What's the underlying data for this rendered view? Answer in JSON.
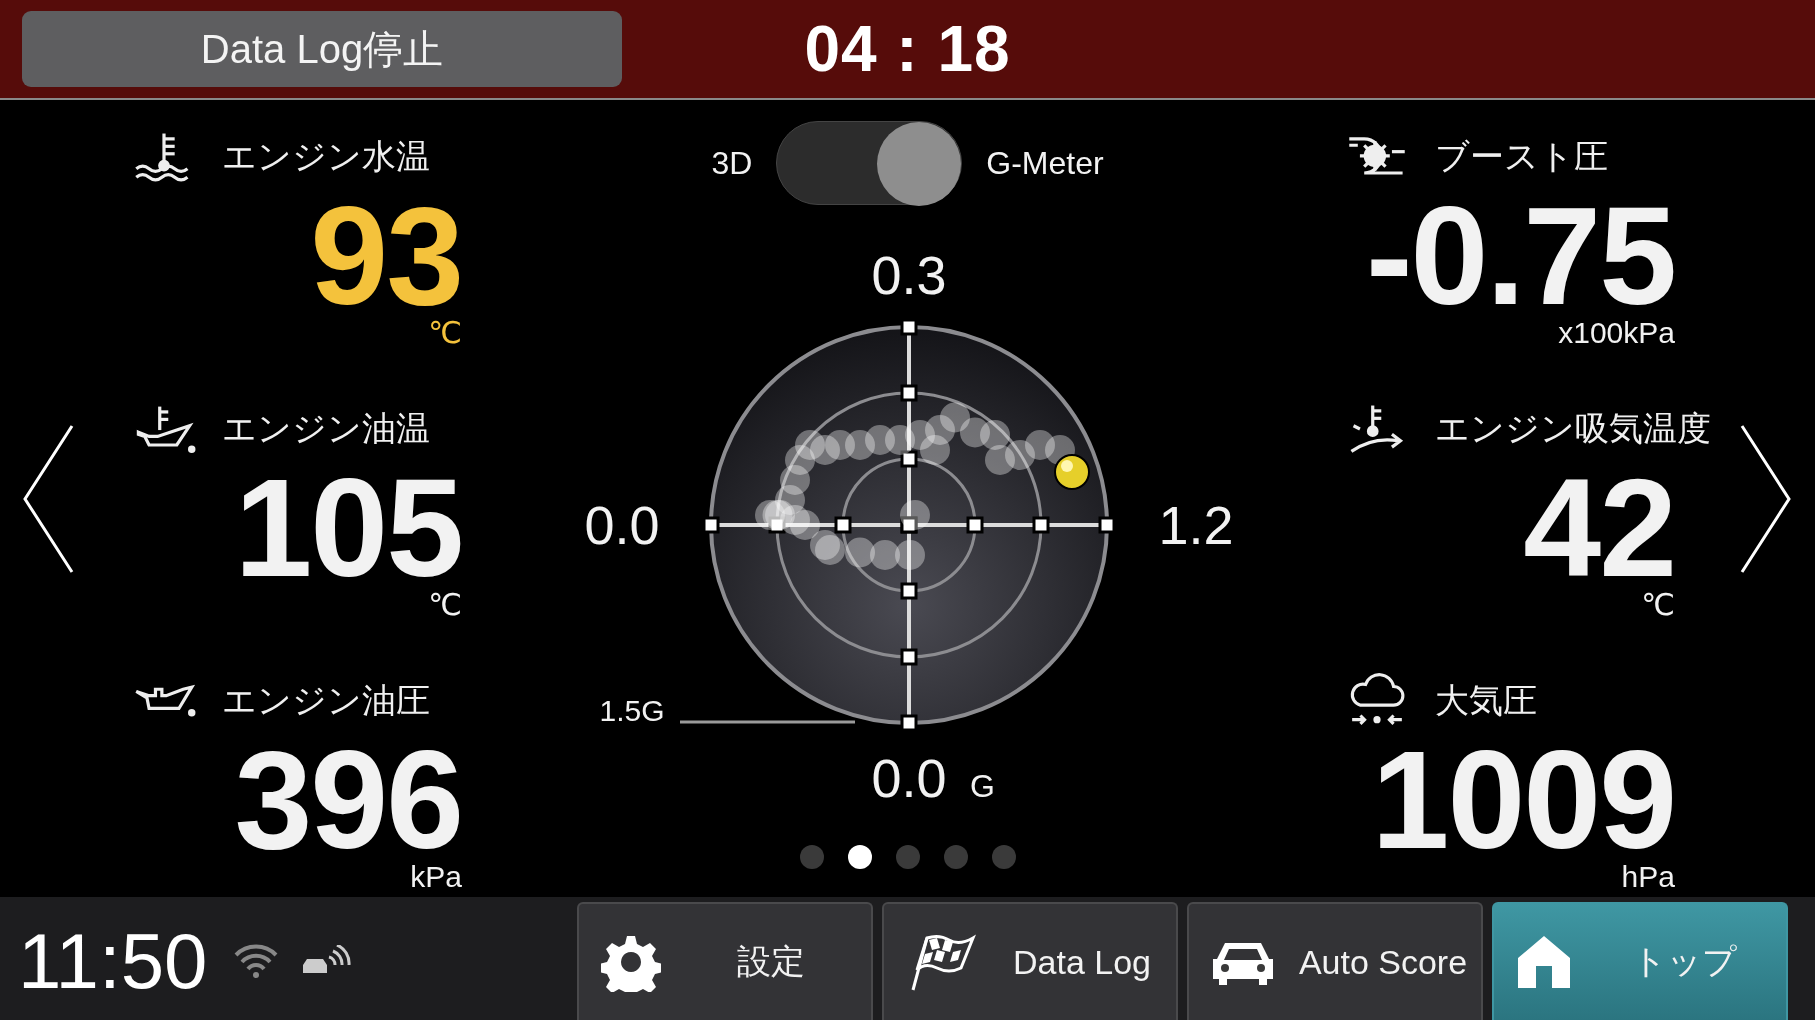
{
  "top_bar": {
    "log_button": "Data Log停止",
    "timer": "04 : 18"
  },
  "left_metrics": [
    {
      "kind": "coolant",
      "label": "エンジン水温",
      "value": "93",
      "unit": "℃",
      "alert": true
    },
    {
      "kind": "oil_temp",
      "label": "エンジン油温",
      "value": "105",
      "unit": "℃",
      "alert": false
    },
    {
      "kind": "oil_pressure",
      "label": "エンジン油圧",
      "value": "396",
      "unit": "kPa",
      "alert": false
    }
  ],
  "view_toggle": {
    "left_label": "3D",
    "right_label": "G-Meter",
    "on": true
  },
  "g_meter": {
    "top_reading": "0.3",
    "left_reading": "0.0",
    "right_reading": "1.2",
    "bottom_reading": "0.0",
    "bottom_unit": "G",
    "scale_label": "1.5G"
  },
  "right_metrics": [
    {
      "kind": "boost",
      "label": "ブースト圧",
      "value": "-0.75",
      "unit": "x100kPa",
      "alert": false
    },
    {
      "kind": "intake_temp",
      "label": "エンジン吸気温度",
      "value": "42",
      "unit": "℃",
      "alert": false
    },
    {
      "kind": "air_pressure",
      "label": "大気圧",
      "value": "1009",
      "unit": "hPa",
      "alert": false
    }
  ],
  "page_dots": [
    {
      "selected": false
    },
    {
      "selected": true
    },
    {
      "selected": false
    },
    {
      "selected": false
    },
    {
      "selected": false
    }
  ],
  "status": {
    "time": "11:50"
  },
  "bottom_buttons": [
    {
      "kind": "settings",
      "label": "設定",
      "selected": false
    },
    {
      "kind": "data_log",
      "label": "Data Log",
      "selected": false
    },
    {
      "kind": "auto_score",
      "label": "Auto Score",
      "selected": false
    },
    {
      "kind": "home",
      "label": "トップ",
      "selected": true
    }
  ]
}
